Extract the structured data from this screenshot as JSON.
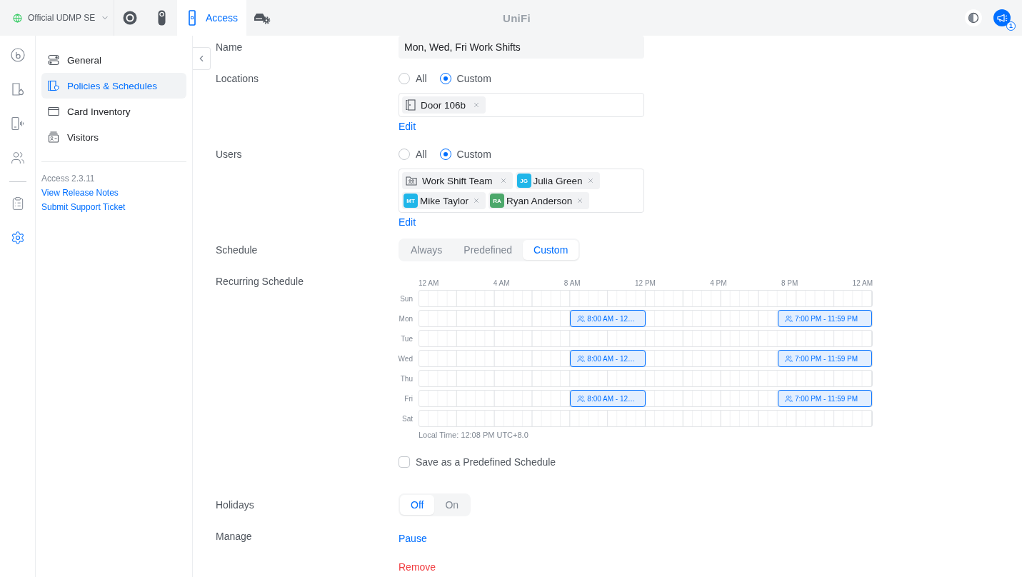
{
  "top_bar": {
    "site": "Official UDMP SE",
    "apps": [
      {
        "kind": "camera",
        "selected": false
      },
      {
        "kind": "doorbell",
        "selected": false
      },
      {
        "kind": "access",
        "label": "Access",
        "selected": true
      },
      {
        "kind": "vehicle",
        "selected": false
      }
    ],
    "logo": "UniFi",
    "notifications": {
      "count": "1"
    }
  },
  "rail": {
    "top": [
      {
        "kind": "dashboard",
        "selected": false
      },
      {
        "kind": "doors",
        "selected": false
      },
      {
        "kind": "devices",
        "selected": false
      },
      {
        "kind": "users",
        "selected": false
      }
    ],
    "bottom": [
      {
        "kind": "logs",
        "selected": false
      },
      {
        "kind": "settings",
        "selected": true
      }
    ]
  },
  "sidebar": {
    "items": [
      {
        "kind": "general",
        "label": "General",
        "selected": false
      },
      {
        "kind": "policies",
        "label": "Policies & Schedules",
        "selected": true
      },
      {
        "kind": "cards",
        "label": "Card Inventory",
        "selected": false
      },
      {
        "kind": "visitors",
        "label": "Visitors",
        "selected": false
      }
    ],
    "version": "Access 2.3.11",
    "links": [
      "View Release Notes",
      "Submit Support Ticket"
    ]
  },
  "form": {
    "name": {
      "label": "Name",
      "value": "Mon, Wed, Fri Work Shifts"
    },
    "locations": {
      "label": "Locations",
      "options": [
        {
          "label": "All",
          "selected": false
        },
        {
          "label": "Custom",
          "selected": true
        }
      ],
      "chips": [
        {
          "kind": "door",
          "label": "Door 106b"
        }
      ],
      "edit": "Edit"
    },
    "users": {
      "label": "Users",
      "options": [
        {
          "label": "All",
          "selected": false
        },
        {
          "label": "Custom",
          "selected": true
        }
      ],
      "chips": [
        {
          "kind": "group",
          "label": "Work Shift Team"
        },
        {
          "kind": "user",
          "initials": "JG",
          "label": "Julia Green",
          "color": "#20b6e9"
        },
        {
          "kind": "user",
          "initials": "MT",
          "label": "Mike Taylor",
          "color": "#20b6e9"
        },
        {
          "kind": "user",
          "initials": "RA",
          "label": "Ryan Anderson",
          "color": "#4ca86b"
        }
      ],
      "edit": "Edit"
    },
    "schedule": {
      "label": "Schedule",
      "options": [
        {
          "label": "Always",
          "selected": false
        },
        {
          "label": "Predefined",
          "selected": false
        },
        {
          "label": "Custom",
          "selected": true
        }
      ]
    },
    "recurring": {
      "label": "Recurring Schedule",
      "hours": [
        "12 AM",
        "4 AM",
        "8 AM",
        "12 PM",
        "4 PM",
        "8 PM",
        "12 AM"
      ],
      "days": [
        {
          "label": "Sun"
        },
        {
          "label": "Mon",
          "events": [
            {
              "kind": "morning",
              "label": "8:00 AM - 12…"
            },
            {
              "kind": "evening",
              "label": "7:00 PM - 11:59 PM"
            }
          ]
        },
        {
          "label": "Tue"
        },
        {
          "label": "Wed",
          "events": [
            {
              "kind": "morning",
              "label": "8:00 AM - 12…"
            },
            {
              "kind": "evening",
              "label": "7:00 PM - 11:59 PM"
            }
          ]
        },
        {
          "label": "Thu"
        },
        {
          "label": "Fri",
          "events": [
            {
              "kind": "morning",
              "label": "8:00 AM - 12…"
            },
            {
              "kind": "evening",
              "label": "7:00 PM - 11:59 PM"
            }
          ]
        },
        {
          "label": "Sat"
        }
      ],
      "local_time": "Local Time: 12:08 PM UTC+8.0",
      "save_predefined": {
        "label": "Save as a Predefined Schedule",
        "checked": false
      }
    },
    "holidays": {
      "label": "Holidays",
      "options": [
        {
          "label": "Off",
          "selected": true
        },
        {
          "label": "On",
          "selected": false
        }
      ]
    },
    "manage": {
      "label": "Manage",
      "actions": [
        {
          "kind": "pause",
          "label": "Pause"
        },
        {
          "kind": "remove",
          "label": "Remove"
        }
      ]
    }
  }
}
